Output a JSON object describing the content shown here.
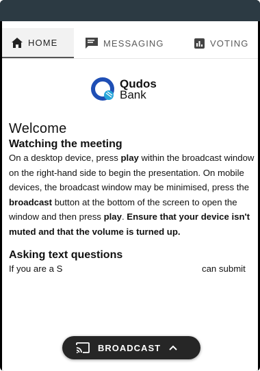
{
  "tabs": [
    {
      "label": "HOME",
      "icon": "home-icon",
      "active": true
    },
    {
      "label": "MESSAGING",
      "icon": "messaging-icon",
      "active": false
    },
    {
      "label": "VOTING",
      "icon": "voting-icon",
      "active": false
    }
  ],
  "logo": {
    "line1": "Qudos",
    "line2": "Bank",
    "brand_color": "#1f4fb5",
    "accent_color": "#27a6d9"
  },
  "article": {
    "welcome": "Welcome",
    "s1_title": "Watching the meeting",
    "s1_a": "On a desktop device, press ",
    "s1_b": "play",
    "s1_c": " within the broadcast window on the right-hand side to begin the presentation. On mobile devices, the broadcast window may be minimised, press the ",
    "s1_d": "broadcast",
    "s1_e": " button at the bottom of the screen to open the window and then press ",
    "s1_f": "play",
    "s1_g": ". ",
    "s1_h": "Ensure that your device isn't muted and that the volume is turned up.",
    "s2_title": "Asking text questions",
    "s2_text": "If you are a S"
  },
  "s2_tail": "can submit",
  "broadcast_button": {
    "label": "BROADCAST"
  },
  "colors": {
    "topbar": "#2c3a43",
    "button_bg": "#262626"
  }
}
